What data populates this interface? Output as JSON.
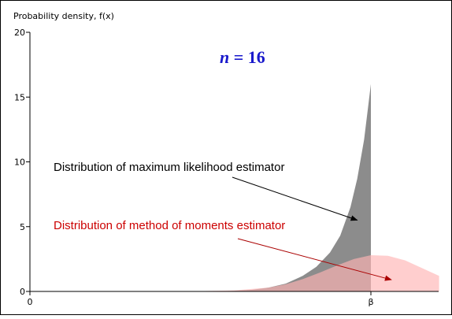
{
  "chart_data": {
    "type": "area",
    "ylabel": "Probability density, f(x)",
    "ylim": [
      0,
      20
    ],
    "y_ticks": [
      0,
      5,
      10,
      15,
      20
    ],
    "y_tick_labels": [
      "0",
      "5",
      "10",
      "15",
      "20"
    ],
    "x_ticks": [
      0,
      1
    ],
    "x_tick_labels": [
      "0",
      "β"
    ],
    "xlim": [
      0,
      1.2
    ],
    "title": "n = 16",
    "title_parts": {
      "italic": "n",
      "rest": " = 16"
    },
    "colors": {
      "mle": "#8c8c8c",
      "mom": "#ffb3b3",
      "ann_mle": "#000000",
      "ann_mom": "#cc0000",
      "title": "#1a1acc"
    },
    "series": [
      {
        "x": [
          0.5,
          0.55,
          0.6,
          0.65,
          0.7,
          0.75,
          0.8,
          0.84,
          0.88,
          0.91,
          0.94,
          0.96,
          0.98,
          1.0
        ],
        "y": [
          0.0,
          0.01,
          0.05,
          0.12,
          0.3,
          0.6,
          1.2,
          1.9,
          3.0,
          4.3,
          6.5,
          8.7,
          11.7,
          16.0
        ],
        "cutoff": 1.0
      },
      {
        "x": [
          0.4,
          0.5,
          0.6,
          0.7,
          0.75,
          0.8,
          0.85,
          0.9,
          0.95,
          1.0,
          1.05,
          1.1,
          1.15,
          1.2
        ],
        "y": [
          0.0,
          0.02,
          0.08,
          0.3,
          0.55,
          0.95,
          1.45,
          2.0,
          2.5,
          2.8,
          2.75,
          2.4,
          1.8,
          1.2
        ]
      }
    ],
    "annotations": [
      {
        "text": "Distribution of maximum likelihood estimator",
        "arrow_to": [
          0.96,
          5.5
        ]
      },
      {
        "text": "Distribution of method of moments estimator",
        "arrow_to": [
          1.06,
          0.9
        ]
      }
    ]
  }
}
